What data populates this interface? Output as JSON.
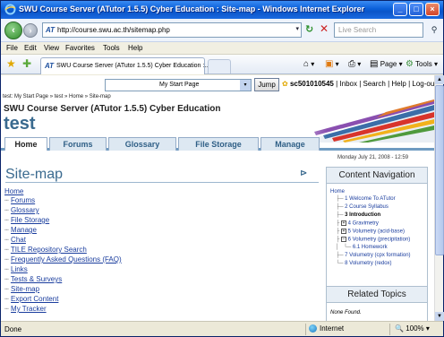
{
  "window": {
    "title": "SWU Course Server (ATutor 1.5.5) Cyber Education : Site-map - Windows Internet Explorer"
  },
  "toolbar": {
    "url": "http://course.swu.ac.th/sitemap.php",
    "search_placeholder": "Live Search"
  },
  "menu": [
    "File",
    "Edit",
    "View",
    "Favorites",
    "Tools",
    "Help"
  ],
  "tabs": {
    "active_label": "SWU Course Server (ATutor 1.5.5) Cyber Education :...",
    "page_label": "Page",
    "tools_label": "Tools"
  },
  "header": {
    "jump_select": "My Start Page",
    "jump_button": "Jump",
    "username": "sc501010545",
    "links": "| Inbox | Search | Help | Log-out",
    "breadcrumb": "test: My Start Page » test » Home » Site-map",
    "site_title": "SWU Course Server (ATutor 1.5.5) Cyber Education",
    "course_name": "test"
  },
  "nav_tabs": [
    "Home",
    "Forums",
    "Glossary",
    "File Storage",
    "Manage"
  ],
  "date": "Monday July 21, 2008 - 12:59",
  "page": {
    "title": "Site-map"
  },
  "sitemap": {
    "root": "Home",
    "items": [
      "Forums",
      "Glossary",
      "File Storage",
      "Manage",
      "Chat",
      "TILE Repository Search",
      "Frequently Asked Questions (FAQ)",
      "Links",
      "Tests & Surveys",
      "Site-map",
      "Export Content",
      "My Tracker"
    ]
  },
  "content_navigation": {
    "title": "Content Navigation",
    "root": "Home",
    "items": [
      {
        "label": "1 Welcome To ATutor",
        "prefix": "├─",
        "box": ""
      },
      {
        "label": "2 Course Syllabus",
        "prefix": "├─",
        "box": ""
      },
      {
        "label": "3 Introduction",
        "prefix": "├─",
        "box": "",
        "current": true
      },
      {
        "label": "4 Gravimetry",
        "prefix": "├",
        "box": "+"
      },
      {
        "label": "5 Volumetry (acid-base)",
        "prefix": "├",
        "box": "+"
      },
      {
        "label": "6 Volumetry (precipitation)",
        "prefix": "├",
        "box": "−"
      },
      {
        "label": "6.1 Homework",
        "prefix": "│   └─",
        "box": ""
      },
      {
        "label": "7 Volumetry (cpx formation)",
        "prefix": "├─",
        "box": ""
      },
      {
        "label": "8 Volumetry (redox)",
        "prefix": "└─",
        "box": ""
      }
    ]
  },
  "related_topics": {
    "title": "Related Topics",
    "empty": "None Found."
  },
  "status": {
    "text": "Done",
    "zone": "Internet",
    "zoom": "100%"
  }
}
